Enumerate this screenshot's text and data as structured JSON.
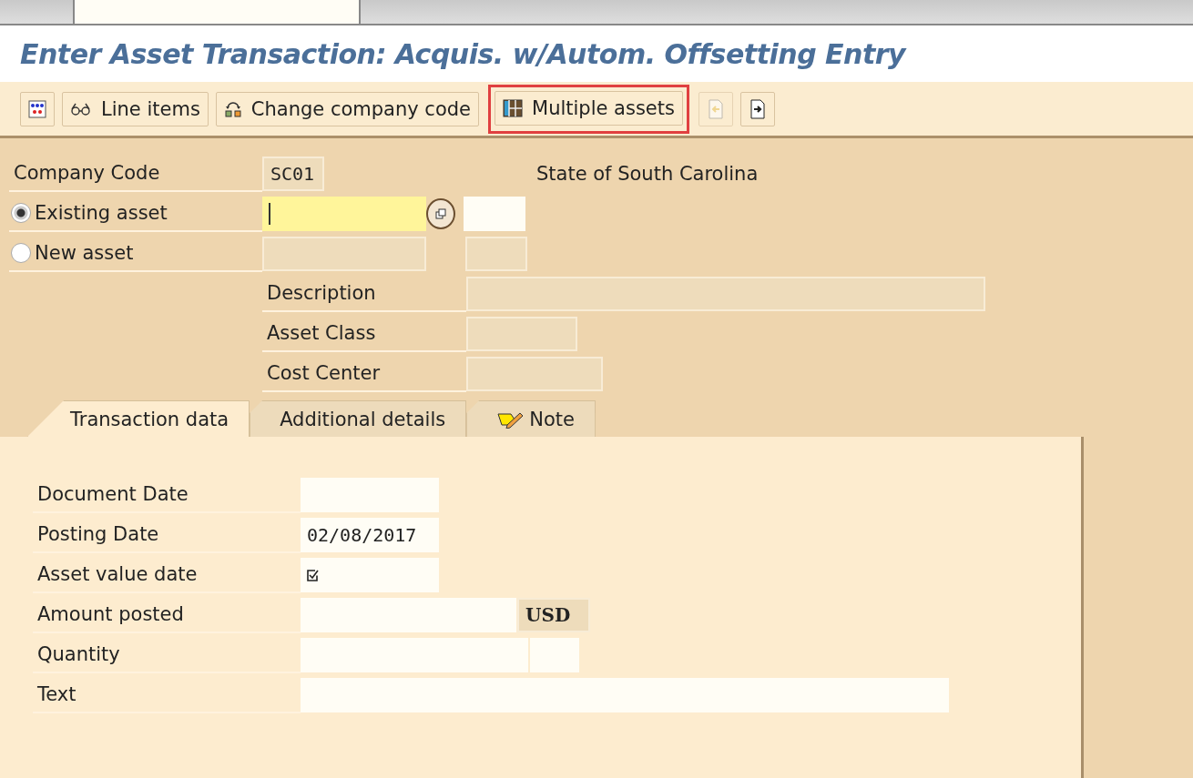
{
  "title": "Enter Asset Transaction: Acquis. w/Autom. Offsetting Entry",
  "toolbar": [
    {
      "kind": "display",
      "highlighted": false,
      "disabled": false
    },
    {
      "kind": "lines",
      "label": "Line items",
      "highlighted": false,
      "disabled": false
    },
    {
      "kind": "company",
      "label": "Change company code",
      "highlighted": false,
      "disabled": false
    },
    {
      "kind": "multiple",
      "label": "Multiple assets",
      "highlighted": true,
      "disabled": false
    },
    {
      "kind": "back",
      "highlighted": false,
      "disabled": true
    },
    {
      "kind": "forward",
      "highlighted": false,
      "disabled": false
    }
  ],
  "company_code": {
    "label": "Company Code",
    "value": "SC01",
    "name": "State of South Carolina"
  },
  "asset_choice": [
    {
      "label": "Existing asset",
      "selected": true
    },
    {
      "label": "New asset",
      "selected": false
    }
  ],
  "asset_fields": [
    {
      "label": "Description",
      "kind": "wide"
    },
    {
      "label": "Asset Class",
      "kind": "short"
    },
    {
      "label": "Cost Center",
      "kind": "medium"
    }
  ],
  "tabs": [
    {
      "label": "Transaction data",
      "selected": true,
      "kind": "plain"
    },
    {
      "label": "Additional details",
      "selected": false,
      "kind": "plain"
    },
    {
      "label": "Note",
      "selected": false,
      "kind": "note"
    }
  ],
  "transaction_fields": [
    {
      "label": "Document Date",
      "kind": "date"
    },
    {
      "label": "Posting Date",
      "kind": "date",
      "value": "02/08/2017"
    },
    {
      "label": "Asset value date",
      "kind": "check"
    },
    {
      "label": "Amount posted",
      "kind": "amount",
      "currency": "USD"
    },
    {
      "label": "Quantity",
      "kind": "quantity"
    },
    {
      "label": "Text",
      "kind": "text"
    }
  ]
}
